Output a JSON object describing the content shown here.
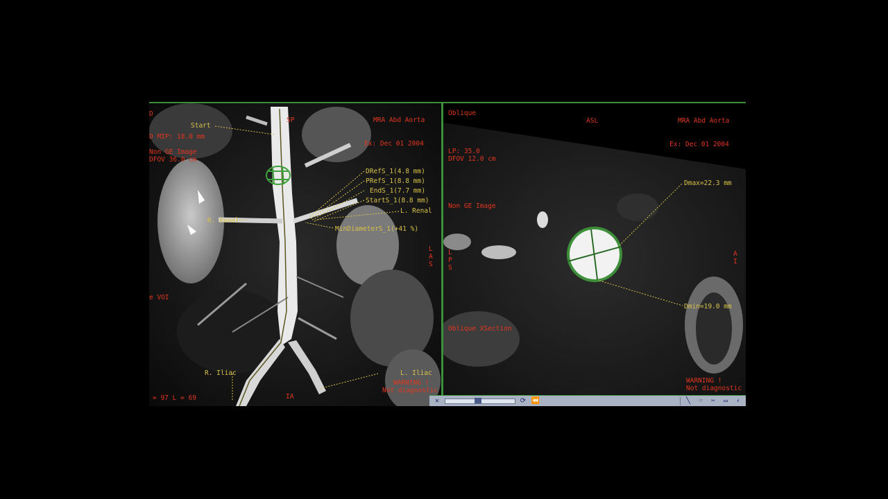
{
  "left_pane": {
    "top_left": [
      "D",
      "D MIP: 18.0 mm",
      "Non GE Image",
      "DFOV 36.0 cm"
    ],
    "series": "MRA Abd Aorta",
    "exam_date": "Ex: Dec 01 2004",
    "start_label": "Start",
    "measurements": [
      "DRefS_1(4.8 mm)",
      "PRefS_1(8.8 mm)",
      "EndS_1(7.7 mm)",
      "StartS_1(8.8 mm)"
    ],
    "l_renal": "L. Renal",
    "r_renal": "R. Renal",
    "min_diameter": "MinDiameterS_1(+41 %)",
    "voi": "e VOI",
    "r_iliac": "R. Iliac",
    "l_iliac": "L. Iliac",
    "warning": "WARNING !",
    "warning_sub": "Not diagnostic",
    "window_level": "= 97 L = 69",
    "orient_top": "SP",
    "orient_right": "L\nA\nS",
    "orient_bottom": "IA"
  },
  "right_pane": {
    "view": "Oblique",
    "orient_top": "ASL",
    "series": "MRA Abd Aorta",
    "exam_date": "Ex: Dec 01 2004",
    "lp": "LP: 35.0",
    "dfov": "DFOV 12.0 cm",
    "non_ge": "Non GE Image",
    "dmax": "Dmax=22.3 mm",
    "dmin": "Dmin=19.0 mm",
    "xsection": "Oblique XSection",
    "orient_left": "L\nP\nS",
    "orient_right": "A\nI",
    "warning": "WARNING !",
    "warning_sub": "Not diagnostic"
  },
  "toolbar": {
    "icons": [
      "close-icon",
      "play-icon",
      "loop-icon",
      "rewind-icon",
      "line-tool-icon",
      "cursor-tool-icon",
      "cut-icon",
      "monitor-icon",
      "arrow-left-icon"
    ]
  },
  "colors": {
    "frame": "#3e8f3a",
    "overlay_red": "#e2361f",
    "annotation_yellow": "#d8c24a"
  }
}
